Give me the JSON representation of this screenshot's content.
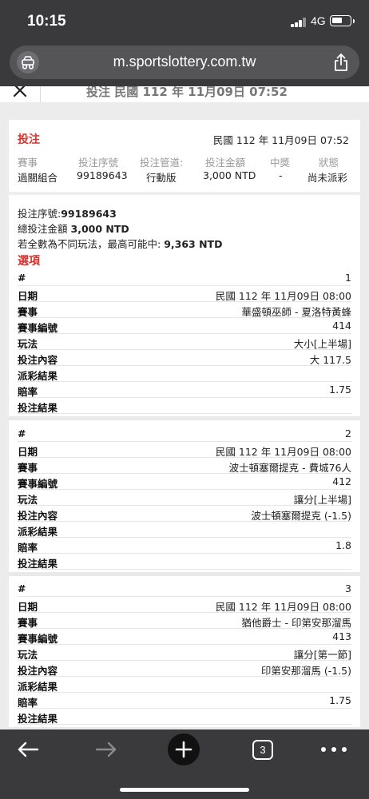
{
  "status_bar": {
    "time": "10:15",
    "network": "4G"
  },
  "browser": {
    "url": "m.sportslottery.com.tw",
    "tab_count": "3"
  },
  "page": {
    "title": "投注 民國 112 年 11月09日 07:52",
    "card_title": "投注",
    "card_date": "民國 112 年 11月09日 07:52",
    "summary_headers": [
      "賽事",
      "投注序號",
      "投注管道:",
      "投注金額",
      "中獎",
      "狀態"
    ],
    "summary_values": [
      "過關組合",
      "99189643",
      "行動版",
      "3,000 NTD",
      "-",
      "尚未派彩"
    ],
    "info": {
      "serial_label": "投注序號:",
      "serial_value": "99189643",
      "amount_label": "總投注金額",
      "amount_value": "3,000 NTD",
      "max_label": "若全數為不同玩法，最高可能中:",
      "max_value": "9,363 NTD"
    },
    "options_title": "選項",
    "row_labels": [
      "#",
      "日期",
      "賽事",
      "賽事編號",
      "玩法",
      "投注內容",
      "派彩結果",
      "賠率",
      "投注結果"
    ],
    "bets": [
      {
        "no": "1",
        "date": "民國 112 年 11月09日 08:00",
        "match": "華盛頓巫師 - 夏洛特黃蜂",
        "match_id": "414",
        "play": "大小[上半場]",
        "pick": "大 117.5",
        "payout": "",
        "odds": "1.75",
        "result": ""
      },
      {
        "no": "2",
        "date": "民國 112 年 11月09日 08:00",
        "match": "波士頓塞爾提克 - 費城76人",
        "match_id": "412",
        "play": "讓分[上半場]",
        "pick": "波士頓塞爾提克 (-1.5)",
        "payout": "",
        "odds": "1.8",
        "result": ""
      },
      {
        "no": "3",
        "date": "民國 112 年 11月09日 08:00",
        "match": "猶他爵士 - 印第安那溜馬",
        "match_id": "413",
        "play": "讓分[第一節]",
        "pick": "印第安那溜馬 (-1.5)",
        "payout": "",
        "odds": "1.75",
        "result": ""
      }
    ]
  }
}
